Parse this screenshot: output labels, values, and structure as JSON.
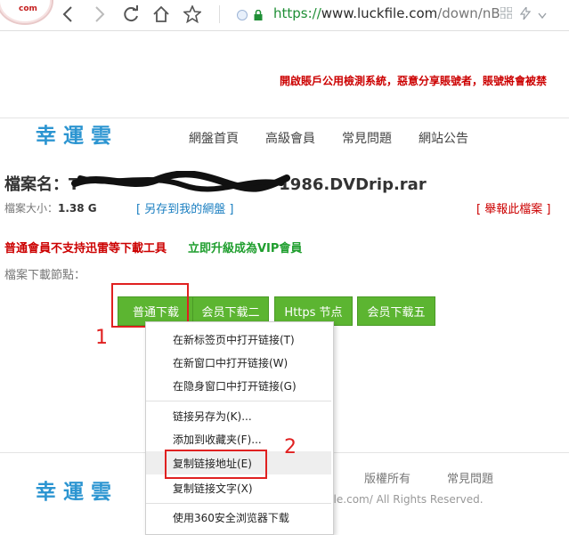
{
  "browser": {
    "logo_text": "com",
    "back_icon": "back-arrow-icon",
    "forward_icon": "forward-arrow-icon",
    "reload_icon": "reload-icon",
    "home_icon": "home-icon",
    "star_icon": "star-icon",
    "url_scheme": "https://",
    "url_host": "www.luckfile.com",
    "url_path": "/down/nB"
  },
  "notice": "開啟賬戶公用檢測系統，惡意分享賬號者，賬號將會被禁",
  "header": {
    "brand": "幸運雲",
    "menu": [
      "網盤首頁",
      "高級會員",
      "常見問題",
      "網站公告"
    ]
  },
  "file": {
    "label": "檔案名：",
    "name_visible_prefix": "T",
    "name_visible_suffix": "1986.DVDrip.rar",
    "size_label": "檔案大小：",
    "size_value": "1.38 G",
    "save_link": "[ 另存到我的網盤 ]",
    "report_link": "[ 舉報此檔案 ]"
  },
  "vip": {
    "notice": "普通會員不支持迅雷等下載工具",
    "upgrade_link": "立即升級成為VIP會員"
  },
  "download": {
    "node_label": "檔案下載節點：",
    "buttons": [
      "普通下载",
      "会员下载二",
      "Https 节点",
      "会员下载五"
    ]
  },
  "annotations": {
    "step1": "1",
    "step2": "2",
    "highlight_color": "#e02020"
  },
  "context_menu": {
    "items": [
      "在新标签页中打开链接(T)",
      "在新窗口中打开链接(W)",
      "在隐身窗口中打开链接(G)",
      "链接另存为(K)...",
      "添加到收藏夹(F)...",
      "复制链接地址(E)",
      "复制链接文字(X)",
      "使用360安全浏览器下载"
    ],
    "highlighted_index": 5
  },
  "footer": {
    "brand": "幸運雲",
    "links": [
      "版權所有",
      "常見問題"
    ],
    "copyright": "file.com/ All Rights Reserved."
  },
  "colors": {
    "accent_blue": "#2c95d1",
    "button_green": "#5cb531",
    "alert_red": "#cc0000",
    "link_green": "#1f9e2e"
  }
}
